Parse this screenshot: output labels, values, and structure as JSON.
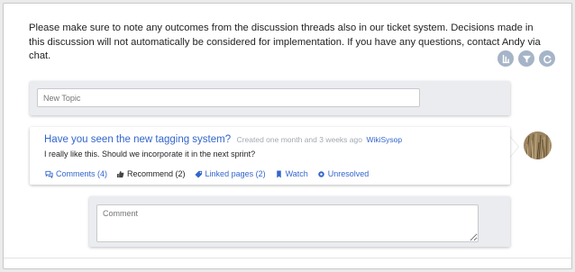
{
  "notice": {
    "text": "Please make sure to note any outcomes from the discussion threads also in our ticket system. Decisions made in this discussion will not automatically be considered for implementation. If you have any questions, contact Andy via chat."
  },
  "toolbar": {
    "buttons": [
      {
        "icon": "sort-icon"
      },
      {
        "icon": "filter-icon"
      },
      {
        "icon": "refresh-icon"
      }
    ],
    "button_color": "#a6b4c7"
  },
  "new_topic": {
    "placeholder": "New Topic"
  },
  "topic": {
    "title": "Have you seen the new tagging system?",
    "meta": "Created one month and 3 weeks ago",
    "author": "WikiSysop",
    "body": "I really like this. Should we incorporate it in the next sprint?",
    "actions": {
      "comments": "Comments (4)",
      "recommend": "Recommend (2)",
      "linked_pages": "Linked pages (2)",
      "watch": "Watch",
      "unresolved": "Unresolved"
    }
  },
  "comment": {
    "placeholder": "Comment"
  },
  "colors": {
    "link": "#3366cc",
    "meta": "#a2a9b1",
    "panel": "#eaecf0"
  }
}
